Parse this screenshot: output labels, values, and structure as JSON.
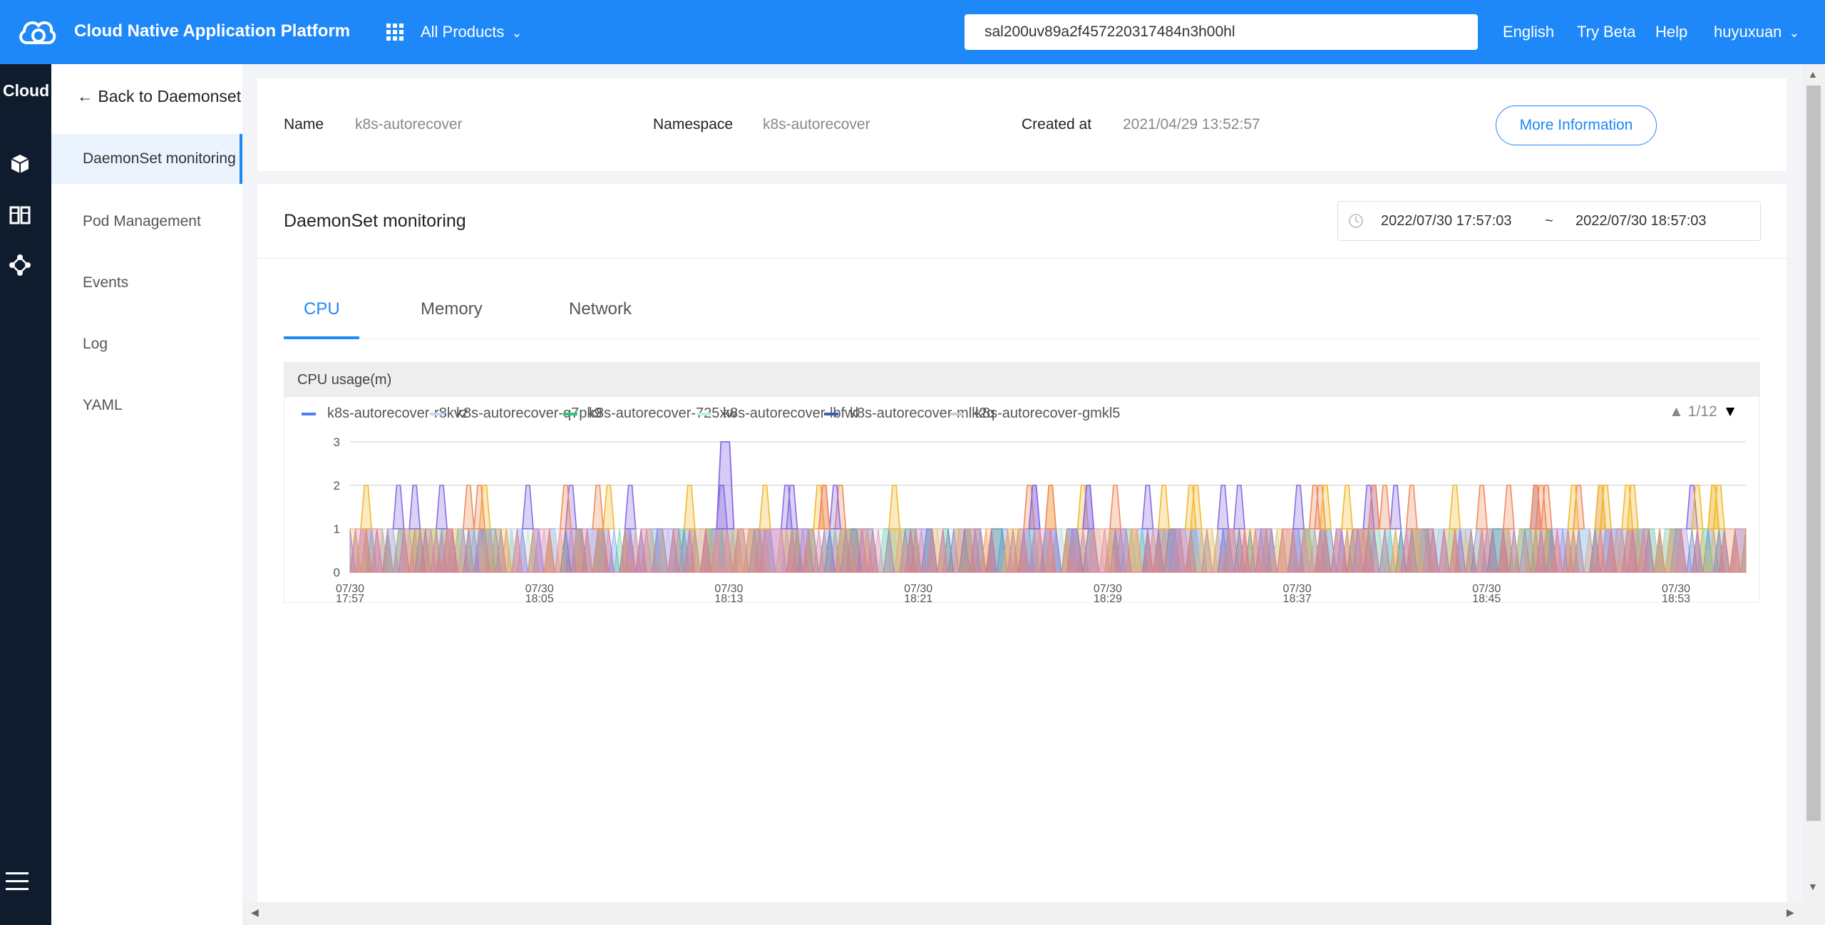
{
  "topbar": {
    "title": "Cloud Native Application Platform",
    "all_products": "All Products",
    "search_value": "sal200uv89a2f457220317484n3h00hl",
    "links": [
      "English",
      "Try Beta",
      "Help",
      "huyuxuan"
    ],
    "bg_color": "#1e88f8"
  },
  "rail": {
    "brand": "Cloud",
    "icons": [
      "cube-icon",
      "columns-icon",
      "share-nodes-icon",
      "hamburger-menu-icon"
    ]
  },
  "subnav": {
    "back": "← Back to Daemonset",
    "items": [
      "DaemonSet monitoring",
      "Pod Management",
      "Events",
      "Log",
      "YAML"
    ],
    "active_index": 0
  },
  "info": {
    "name_label": "Name",
    "name_value": "k8s-autorecover",
    "namespace_label": "Namespace",
    "namespace_value": "k8s-autorecover",
    "created_label": "Created at",
    "created_value": "2021/04/29 13:52:57",
    "more_button": "More Information"
  },
  "monitoring": {
    "title": "DaemonSet monitoring",
    "time_start": "2022/07/30 17:57:03",
    "time_sep": "~",
    "time_end": "2022/07/30 18:57:03",
    "tabs": [
      "CPU",
      "Memory",
      "Network"
    ],
    "active_tab": 0,
    "chart_title": "CPU usage(m)",
    "pager": "1/12"
  },
  "chart_data": {
    "type": "area",
    "title": "CPU usage(m)",
    "ylim": [
      0,
      3
    ],
    "yticks": [
      "0",
      "1",
      "2",
      "3"
    ],
    "xticks": [
      {
        "date": "07/30",
        "time": "17:57"
      },
      {
        "date": "07/30",
        "time": "18:05"
      },
      {
        "date": "07/30",
        "time": "18:13"
      },
      {
        "date": "07/30",
        "time": "18:21"
      },
      {
        "date": "07/30",
        "time": "18:29"
      },
      {
        "date": "07/30",
        "time": "18:37"
      },
      {
        "date": "07/30",
        "time": "18:45"
      },
      {
        "date": "07/30",
        "time": "18:53"
      }
    ],
    "grid": true,
    "legend_position": "top",
    "series": [
      {
        "name": "k8s-autorecover-r8kvz",
        "color": "#4d7ef7"
      },
      {
        "name": "k8s-autorecover-q7pk9",
        "color": "#c9d7f7"
      },
      {
        "name": "k8s-autorecover-725xw",
        "color": "#33c37e"
      },
      {
        "name": "k8s-autorecover-lbfwl",
        "color": "#bff0de"
      },
      {
        "name": "k8s-autorecover-mlk2q",
        "color": "#3e5ca8"
      },
      {
        "name": "k8s-autorecover-gmkl5",
        "color": "#cfcfcf"
      }
    ],
    "highlight_series_colors": [
      "#f3b82e",
      "#8a6be0",
      "#f08a5d"
    ],
    "notes": "Dense overlapping areas; most series oscillate between 0 and 1, spikes to 2, single peak to 3 near 18:13."
  }
}
